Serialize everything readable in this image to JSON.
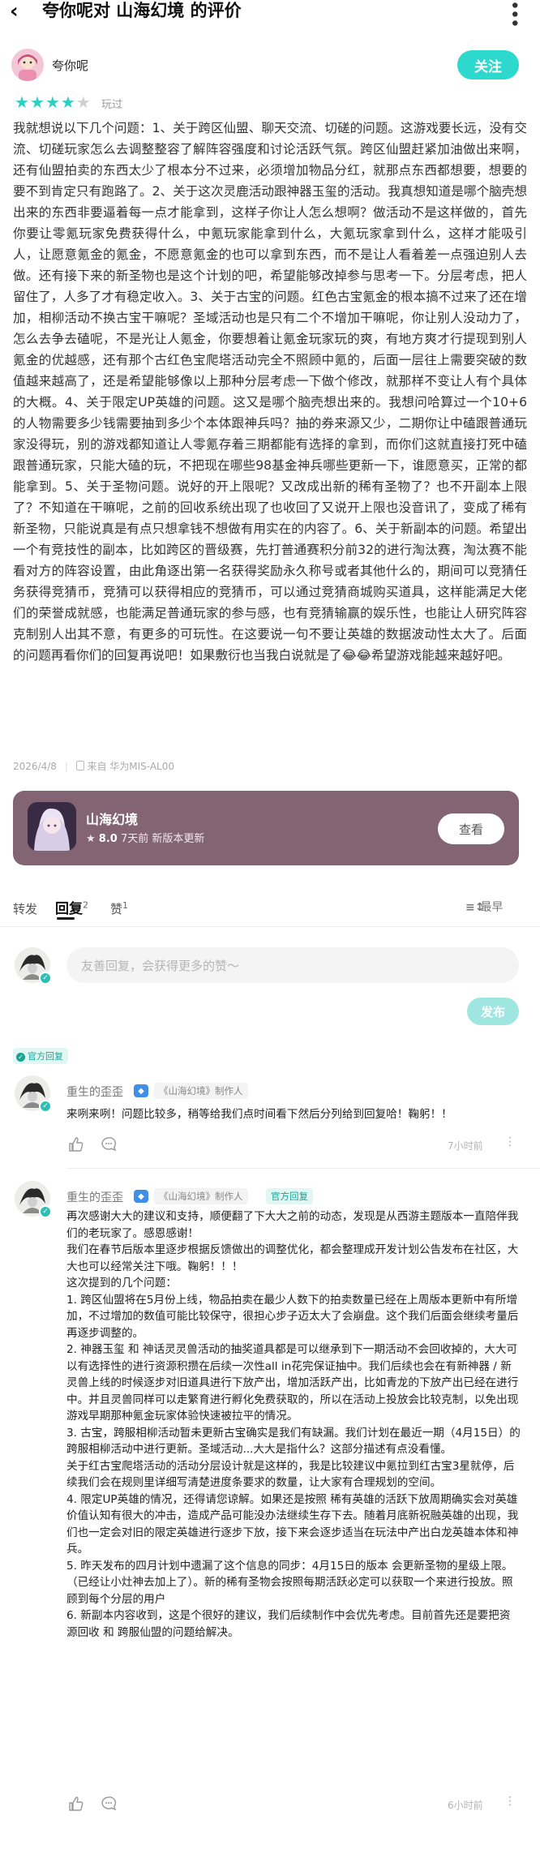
{
  "header": {
    "back_icon": "chevron-left-icon",
    "title": "夸你呢对 山海幻境 的评价",
    "more_icon": "more-vertical-icon"
  },
  "reviewer": {
    "name": "夸你呢",
    "follow_label": "关注",
    "rating": 4,
    "rating_max": 5,
    "status": "玩过"
  },
  "review": {
    "paragraphs": [
      "我就想说以下几个问题：1、关于跨区仙盟、聊天交流、切磋的问题。这游戏要长远，没有交流、切磋玩家怎么去调整整容了解阵容强度和讨论活跃气氛。跨区仙盟赶紧加油做出来啊，还有仙盟拍卖的东西太少了根本分不过来，必须增加物品分红，就那点东西都想要，想要的要不到肯定只有跑路了。2、关于这次灵鹿活动跟神器玉玺的活动。我真想知道是哪个脑壳想出来的东西非要逼着每一点才能拿到，这样子你让人怎么想啊？做活动不是这样做的，首先你要让零氪玩家免费获得什么，中氪玩家能拿到什么，大氪玩家拿到什么，这样才能吸引人，让愿意氪金的氪金，不愿意氪金的也可以拿到东西，而不是让人看着差一点强迫别人去做。还有接下来的新圣物也是这个计划的吧，希望能够改掉参与思考一下。分层考虑，把人留住了，人多了才有稳定收入。3、关于古宝的问题。红色古宝氪金的根本搞不过来了还在增加，相柳活动不换古宝干嘛呢？圣域活动也是只有二个不增加干嘛呢，你让别人没动力了，怎么去争去磕呢，不是光让人氪金，你要想着让氪金玩家玩的爽，有地方爽才行提现到别人氪金的优越感，还有那个古红色宝爬塔活动完全不照顾中氪的，后面一层往上需要突破的数值越来越高了，还是希望能够像以上那种分层考虑一下做个修改，就那样不变让人有个具体的大概。4、关于限定UP英雄的问题。这又是哪个脑壳想出来的。我想问哈算过一个10+6的人物需要多少钱需要抽到多少个本体跟神兵吗？抽的券来源又少，二期你让中磕跟普通玩家没得玩，别的游戏都知道让人零氪存着三期都能有选择的拿到，而你们这就直接打死中磕跟普通玩家，只能大磕的玩，不把现在哪些98基金神兵哪些更新一下，谁愿意买，正常的都能拿到。5、关于圣物问题。说好的开上限呢？又改成出新的稀有圣物了？也不开副本上限了？不知道在干嘛呢，之前的回收系统出现了也收回了又说开上限也没音讯了，变成了稀有新圣物，只能说真是有点只想拿钱不想做有用实在的内容了。6、关于新副本的问题。希望出一个有竞技性的副本，比如跨区的晋级赛，先打普通赛积分前32的进行淘汰赛，淘汰赛不能看对方的阵容设置，由此角逐出第一名获得奖励永久称号或者其他什么的，期间可以竞猜任务获得竞猜币，竞猜可以获得相应的竞猜币，可以通过竞猜商城购买道具，这样能满足大佬们的荣誉成就感，也能满足普通玩家的参与感，也有竞猜输赢的娱乐性，也能让人研究阵容克制别人出其不意，有更多的可玩性。在这要说一句不要让英雄的数据波动性太大了。后面的问题再看你们的回复再说吧！如果敷衍也当我白说就是了😂😂希望游戏能越来越好吧。"
    ],
    "date": "2026/4/8",
    "source": "来自 华为MIS-AL00"
  },
  "game_card": {
    "name": "山海幻境",
    "score": "8.0",
    "updated": "7天前 新版本更新",
    "view_label": "查看"
  },
  "tabs": {
    "share": "转发",
    "reply": "回复",
    "reply_count": "2",
    "like": "赞",
    "like_count": "1",
    "sort": "最早"
  },
  "composer": {
    "placeholder": "友善回复，会获得更多的赞～",
    "publish_label": "发布"
  },
  "official_tag": "官方回复",
  "comments": [
    {
      "name": "重生的歪歪",
      "dev_icon": "developer-icon",
      "role": "《山海幻境》制作人",
      "badge": "",
      "paragraphs": [
        "来咧来咧！问题比较多，稍等给我们点时间看下然后分列给到回复哈！鞠躬！！"
      ],
      "time": "7小时前"
    },
    {
      "name": "重生的歪歪",
      "dev_icon": "developer-icon",
      "role": "《山海幻境》制作人",
      "badge": "官方回复",
      "paragraphs": [
        "再次感谢大大的建议和支持，顺便翻了下大大之前的动态，发现是从西游主题版本一直陪伴我们的老玩家了。感恩感谢！",
        "我们在春节后版本里逐步根据反馈做出的调整优化，都会整理成开发计划公告发布在社区，大大也可以经常关注下哦。鞠躬！！！",
        "这次提到的几个问题：",
        "1. 跨区仙盟将在5月份上线，物品拍卖在最少人数下的拍卖数量已经在上周版本更新中有所增加，不过增加的数值可能比较保守，很担心步子迈太大了会崩盘。这个我们后面会继续考量后再逐步调整的。",
        "2. 神器玉玺 和 神话灵灵兽活动的抽奖道具都是可以继承到下一期活动不会回收掉的，大大可以有选择性的进行资源积攒在后续一次性all in花完保证抽中。我们后续也会在有新神器 / 新灵兽上线的时候逐步对旧道具进行下放产出，增加活跃产出，比如青龙的下放产出已经在进行中。并且灵兽同样可以走繁育进行孵化免费获取的，所以在活动上投放会比较克制，以免出现游戏早期那种氪金玩家体验快速被拉平的情况。",
        "3. 古宝，跨服相柳活动暂未更新古宝确实是我们有缺漏。我们计划在最近一期（4月15日）的跨服相柳活动中进行更新。圣域活动...大大是指什么？这部分描述有点没看懂。",
        "关于红古宝爬塔活动的活动分层设计就是这样的，我是比较建议中氪拉到红古宝3星就停，后续我们会在规则里详细写清楚进度条要求的数量，让大家有合理规划的空间。",
        "4. 限定UP英雄的情况，还得请您谅解。如果还是按照 稀有英雄的活跃下放周期确实会对英雄价值认知有很大的冲击，造成产品可能没办法继续生存下去。随着月底新祝融英雄的出现，我们也一定会对旧的限定英雄进行逐步下放，接下来会逐步适当在玩法中产出白龙英雄本体和神兵。",
        "5. 昨天发布的四月计划中遗漏了这个信息的同步：4月15日的版本 会更新圣物的星级上限。（已经让小灶神去加上了）。新的稀有圣物会按照每期活跃必定可以获取一个来进行投放。照顾到每个分层的用户",
        "6. 新副本内容收到，这是个很好的建议，我们后续制作中会优先考虑。目前首先还是要把资源回收 和 跨服仙盟的问题给解决。"
      ],
      "time": "6小时前"
    }
  ]
}
